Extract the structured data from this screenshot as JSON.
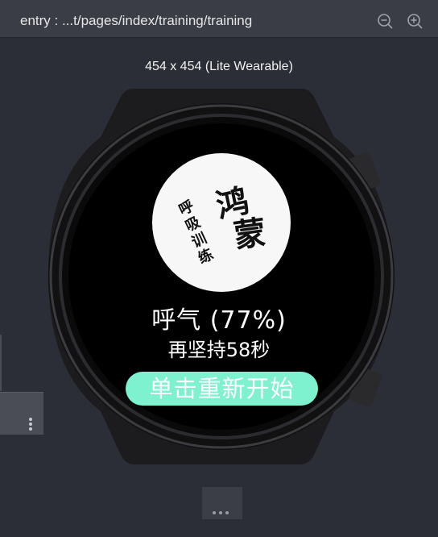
{
  "toolbar": {
    "entry_path": "entry : ...t/pages/index/training/training",
    "zoom_out_icon": "zoom-out-icon",
    "zoom_in_icon": "zoom-in-icon"
  },
  "device": {
    "label": "454 x 454 (Lite Wearable)"
  },
  "watch_screen": {
    "logo": {
      "title_chars": [
        "鸿",
        "蒙"
      ],
      "subtitle_chars": [
        "呼",
        "吸",
        "训",
        "练"
      ]
    },
    "breath_status": "呼气 (77%)",
    "hold_on_text": "再坚持58秒",
    "restart_button": "单击重新开始",
    "button_color": "#7ef2cf"
  },
  "side_panel": {
    "more_icon": "more-vertical-icon"
  },
  "bottom": {
    "more_icon": "more-horizontal-icon"
  }
}
